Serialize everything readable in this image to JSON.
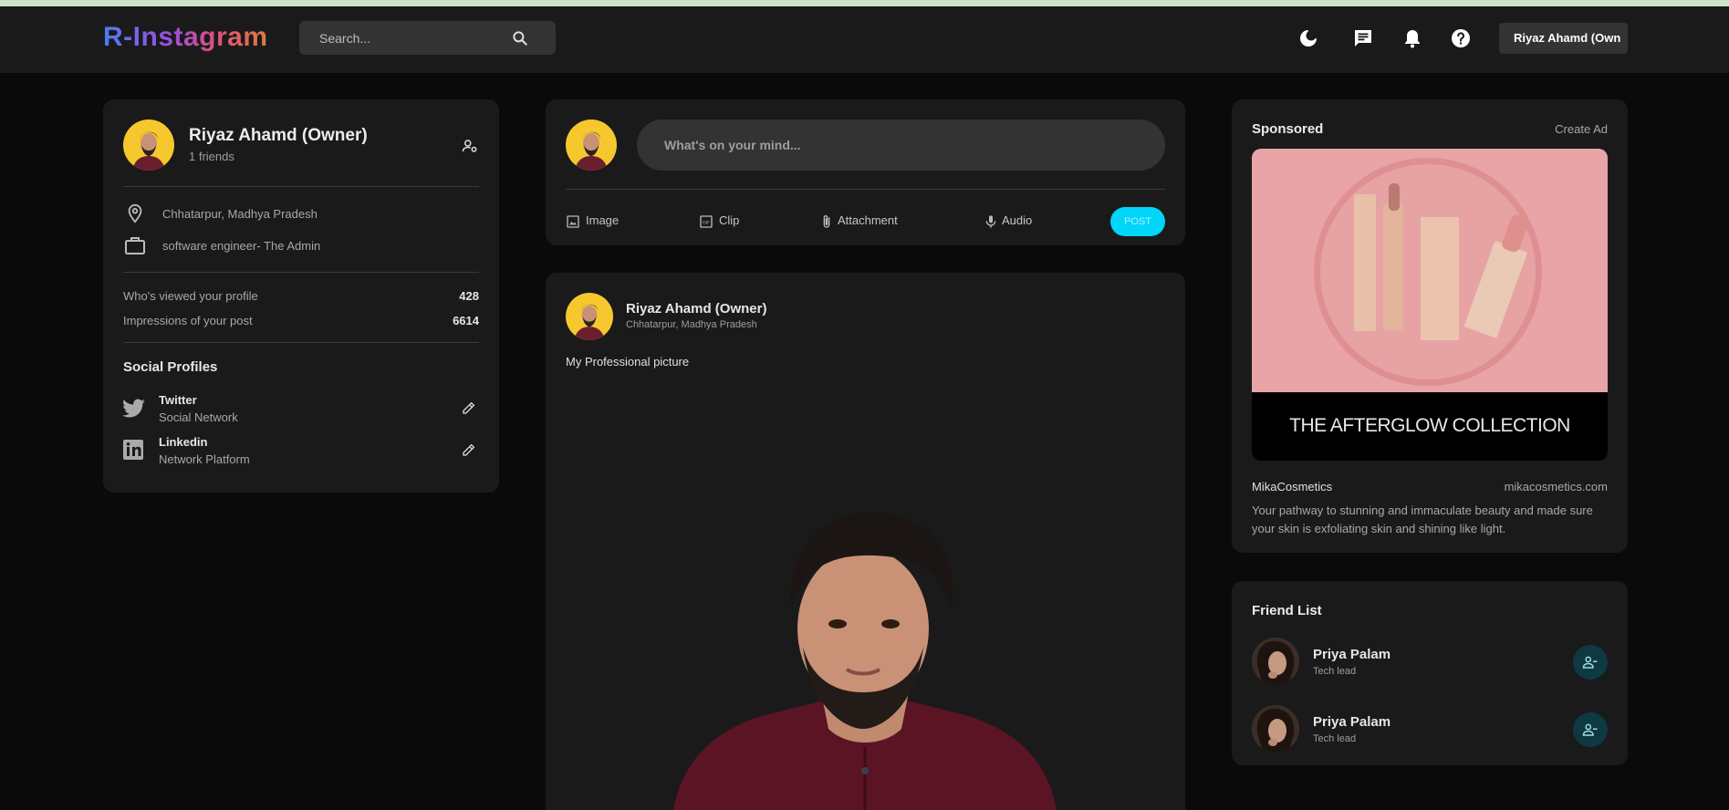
{
  "app": {
    "logo": "R-Instagram"
  },
  "navbar": {
    "search_placeholder": "Search...",
    "icons": [
      "search-icon",
      "moon-icon",
      "message-icon",
      "bell-icon",
      "help-icon"
    ],
    "user_button": "Riyaz Ahamd (Own"
  },
  "profile": {
    "name": "Riyaz Ahamd (Owner)",
    "friends": "1 friends",
    "location": "Chhatarpur, Madhya Pradesh",
    "occupation": "software engineer- The Admin",
    "stats": [
      {
        "label": "Who's viewed your profile",
        "value": "428"
      },
      {
        "label": "Impressions of your post",
        "value": "6614"
      }
    ],
    "social_title": "Social Profiles",
    "social": [
      {
        "name": "Twitter",
        "type": "Social Network",
        "icon": "twitter-icon"
      },
      {
        "name": "Linkedin",
        "type": "Network Platform",
        "icon": "linkedin-icon"
      }
    ]
  },
  "composer": {
    "placeholder": "What's on your mind...",
    "actions": [
      {
        "label": "Image",
        "icon": "image-icon"
      },
      {
        "label": "Clip",
        "icon": "gif-icon"
      },
      {
        "label": "Attachment",
        "icon": "paperclip-icon"
      },
      {
        "label": "Audio",
        "icon": "microphone-icon"
      }
    ],
    "post_label": "POST"
  },
  "post": {
    "author": "Riyaz Ahamd (Owner)",
    "location": "Chhatarpur, Madhya Pradesh",
    "caption": "My Professional picture"
  },
  "sponsored": {
    "title": "Sponsored",
    "create_ad": "Create Ad",
    "ad_image_text": "THE AFTERGLOW COLLECTION",
    "brand": "MikaCosmetics",
    "site": "mikacosmetics.com",
    "description_line1": "Your pathway to stunning and immaculate beauty and made sure",
    "description_line2": "your skin is exfoliating skin and shining like light."
  },
  "friends": {
    "title": "Friend List",
    "items": [
      {
        "name": "Priya Palam",
        "role": "Tech lead"
      },
      {
        "name": "Priya Palam",
        "role": "Tech lead"
      }
    ]
  },
  "colors": {
    "accent": "#00d5fa",
    "card": "#1a1a1a",
    "background": "#0a0a0a"
  }
}
